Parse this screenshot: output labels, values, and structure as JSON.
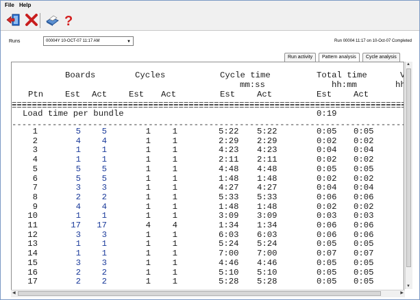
{
  "menu": {
    "file": "File",
    "help": "Help"
  },
  "toolbar": {
    "icons": [
      "exit-icon",
      "delete-icon",
      "print-icon",
      "help-icon"
    ]
  },
  "runs": {
    "label": "Runs",
    "selected": "00004Y  10-OCT-07 11:17 AM",
    "status": "Run 00004  11:17 on 10-Oct-07  Completed"
  },
  "tabs": [
    {
      "label": "Run activity",
      "active": false
    },
    {
      "label": "Pattern analysis",
      "active": true
    },
    {
      "label": "Cycle analysis",
      "active": false
    }
  ],
  "report": {
    "headers": {
      "boards": "Boards",
      "cycles": "Cycles",
      "cycle_time": "Cycle time",
      "cycle_time_unit": "mm:ss",
      "total_time": "Total time",
      "total_time_unit": "hh:mm",
      "clipped_header": "V",
      "clipped_unit": "hh",
      "ptn": "Ptn",
      "est": "Est",
      "act": "Act"
    },
    "load_label": "Load time per bundle",
    "load_value": "0:19",
    "rows": [
      [
        "1",
        "5",
        "5",
        "1",
        "1",
        "5:22",
        "5:22",
        "0:05",
        "0:05"
      ],
      [
        "2",
        "4",
        "4",
        "1",
        "1",
        "2:29",
        "2:29",
        "0:02",
        "0:02"
      ],
      [
        "3",
        "1",
        "1",
        "1",
        "1",
        "4:23",
        "4:23",
        "0:04",
        "0:04"
      ],
      [
        "4",
        "1",
        "1",
        "1",
        "1",
        "2:11",
        "2:11",
        "0:02",
        "0:02"
      ],
      [
        "5",
        "5",
        "5",
        "1",
        "1",
        "4:48",
        "4:48",
        "0:05",
        "0:05"
      ],
      [
        "6",
        "5",
        "5",
        "1",
        "1",
        "1:48",
        "1:48",
        "0:02",
        "0:02"
      ],
      [
        "7",
        "3",
        "3",
        "1",
        "1",
        "4:27",
        "4:27",
        "0:04",
        "0:04"
      ],
      [
        "8",
        "2",
        "2",
        "1",
        "1",
        "5:33",
        "5:33",
        "0:06",
        "0:06"
      ],
      [
        "9",
        "4",
        "4",
        "1",
        "1",
        "1:48",
        "1:48",
        "0:02",
        "0:02"
      ],
      [
        "10",
        "1",
        "1",
        "1",
        "1",
        "3:09",
        "3:09",
        "0:03",
        "0:03"
      ],
      [
        "11",
        "17",
        "17",
        "4",
        "4",
        "1:34",
        "1:34",
        "0:06",
        "0:06"
      ],
      [
        "12",
        "3",
        "3",
        "1",
        "1",
        "6:03",
        "6:03",
        "0:06",
        "0:06"
      ],
      [
        "13",
        "1",
        "1",
        "1",
        "1",
        "5:24",
        "5:24",
        "0:05",
        "0:05"
      ],
      [
        "14",
        "1",
        "1",
        "1",
        "1",
        "7:00",
        "7:00",
        "0:07",
        "0:07"
      ],
      [
        "15",
        "3",
        "3",
        "1",
        "1",
        "4:46",
        "4:46",
        "0:05",
        "0:05"
      ],
      [
        "16",
        "2",
        "2",
        "1",
        "1",
        "5:10",
        "5:10",
        "0:05",
        "0:05"
      ],
      [
        "17",
        "2",
        "2",
        "1",
        "1",
        "5:28",
        "5:28",
        "0:05",
        "0:05"
      ]
    ]
  }
}
